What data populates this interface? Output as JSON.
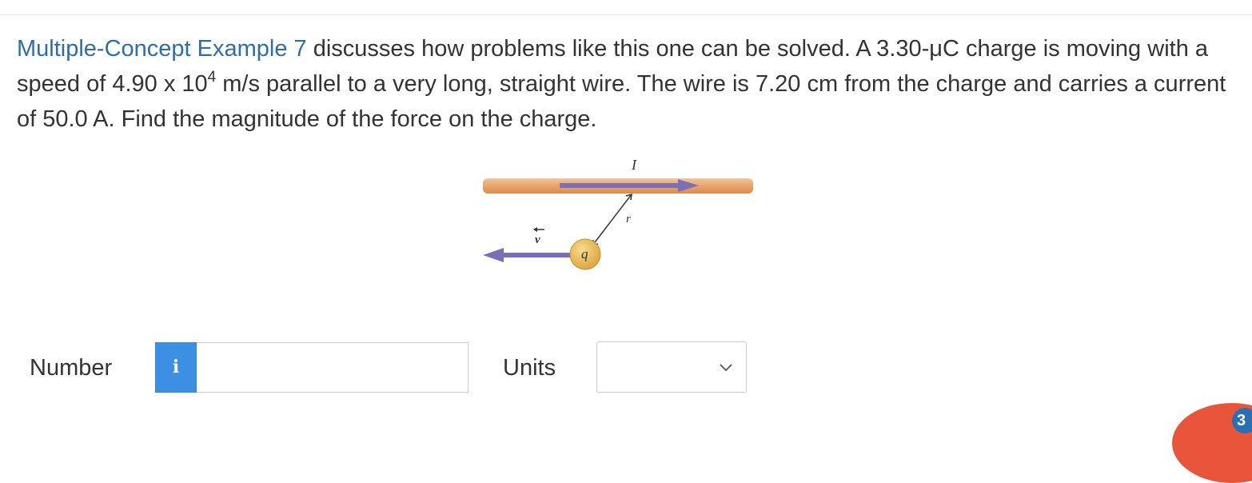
{
  "question": {
    "link_text": "Multiple-Concept Example 7",
    "text_part1": " discusses how problems like this one can be solved. A 3.30-μC charge is moving with a speed of 4.90 x 10",
    "exponent": "4",
    "text_part2": " m/s parallel to a very long, straight wire. The wire is 7.20 cm from the charge and carries a current of 50.0 A. Find the magnitude of the force on the charge."
  },
  "figure": {
    "current_label": "I",
    "distance_label": "r",
    "charge_label": "q",
    "velocity_label": "v",
    "colors": {
      "wire": "#e8a46c",
      "arrow": "#7b6fba",
      "charge": "#e9b44c"
    }
  },
  "answer": {
    "number_label": "Number",
    "info_icon": "i",
    "number_value": "",
    "units_label": "Units",
    "units_value": ""
  },
  "badge": {
    "count": "3"
  }
}
